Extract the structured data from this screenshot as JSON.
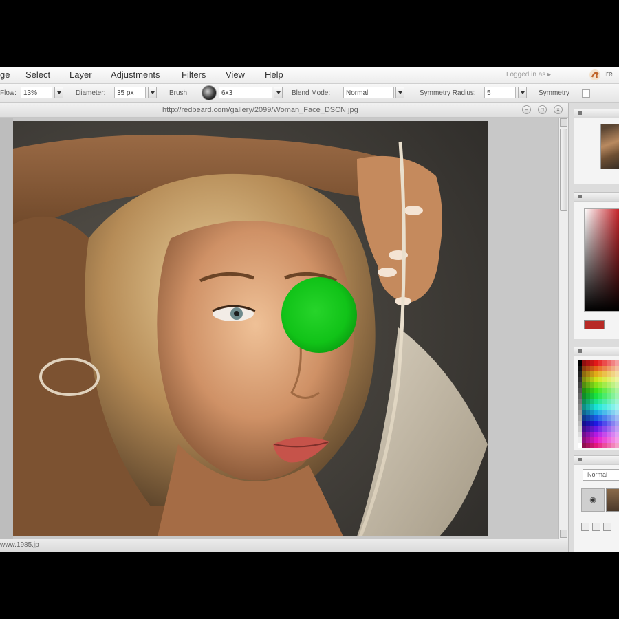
{
  "menubar": {
    "items": [
      "ge",
      "Select",
      "Layer",
      "Adjustments",
      "Filters",
      "View",
      "Help"
    ],
    "user_label": "Logged in as ▸",
    "user_name": "Ire"
  },
  "options": {
    "zoom_label": "Flow:",
    "zoom_value": "13%",
    "diameter_label": "Diameter:",
    "diameter_value": "35 px",
    "brush_label": "Brush:",
    "brush_value": "6x3",
    "blend_label": "Blend Mode:",
    "blend_value": "Normal",
    "symmetry_label": "Symmetry Radius:",
    "symmetry_value": "5",
    "symmetry_check_label": "Symmetry"
  },
  "document": {
    "title_url": "http://redbeard.com/gallery/2099/Woman_Face_DSCN.jpg",
    "window_buttons": [
      "–",
      "□",
      "×"
    ]
  },
  "status": {
    "text": "www.1985.jp"
  },
  "panels": {
    "layer_mode": "Normal",
    "layer_eye_icon": "◉",
    "colors": {
      "foreground": "#b72a26",
      "gradient_base": "#c6242a"
    }
  },
  "photo": {
    "overlay_color": "#11c318"
  }
}
